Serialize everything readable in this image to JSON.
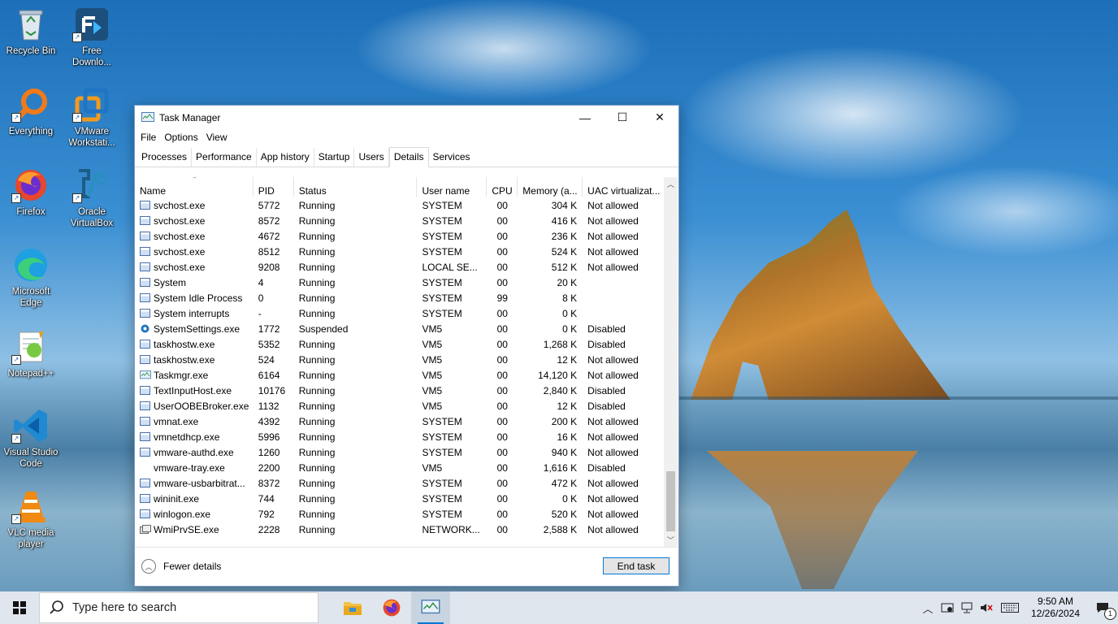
{
  "desktop": {
    "icons": [
      {
        "label": "Recycle Bin",
        "icon": "recycle-bin-icon"
      },
      {
        "label": "Free\nDownlo...",
        "icon": "free-download-manager-icon"
      },
      {
        "label": "Everything",
        "icon": "everything-search-icon"
      },
      {
        "label": "VMware\nWorkstati...",
        "icon": "vmware-workstation-icon"
      },
      {
        "label": "Firefox",
        "icon": "firefox-icon"
      },
      {
        "label": "Oracle\nVirtualBox",
        "icon": "virtualbox-icon"
      },
      {
        "label": "Microsoft\nEdge",
        "icon": "edge-icon"
      },
      {
        "label": "Notepad++",
        "icon": "notepadpp-icon"
      },
      {
        "label": "Visual Studio\nCode",
        "icon": "vscode-icon"
      },
      {
        "label": "VLC media\nplayer",
        "icon": "vlc-icon"
      }
    ]
  },
  "window": {
    "title": "Task Manager",
    "controls": {
      "minimize": "—",
      "maximize": "☐",
      "close": "✕"
    },
    "menu": [
      "File",
      "Options",
      "View"
    ],
    "tabs": [
      "Processes",
      "Performance",
      "App history",
      "Startup",
      "Users",
      "Details",
      "Services"
    ],
    "active_tab": "Details",
    "columns": [
      "Name",
      "PID",
      "Status",
      "User name",
      "CPU",
      "Memory (a...",
      "UAC virtualizat..."
    ],
    "rows": [
      {
        "name": "svchost.exe",
        "pid": "5772",
        "status": "Running",
        "user": "SYSTEM",
        "cpu": "00",
        "mem": "304 K",
        "uac": "Not allowed",
        "icon": "service-host"
      },
      {
        "name": "svchost.exe",
        "pid": "8572",
        "status": "Running",
        "user": "SYSTEM",
        "cpu": "00",
        "mem": "416 K",
        "uac": "Not allowed",
        "icon": "service-host"
      },
      {
        "name": "svchost.exe",
        "pid": "4672",
        "status": "Running",
        "user": "SYSTEM",
        "cpu": "00",
        "mem": "236 K",
        "uac": "Not allowed",
        "icon": "service-host"
      },
      {
        "name": "svchost.exe",
        "pid": "8512",
        "status": "Running",
        "user": "SYSTEM",
        "cpu": "00",
        "mem": "524 K",
        "uac": "Not allowed",
        "icon": "service-host"
      },
      {
        "name": "svchost.exe",
        "pid": "9208",
        "status": "Running",
        "user": "LOCAL SE...",
        "cpu": "00",
        "mem": "512 K",
        "uac": "Not allowed",
        "icon": "service-host"
      },
      {
        "name": "System",
        "pid": "4",
        "status": "Running",
        "user": "SYSTEM",
        "cpu": "00",
        "mem": "20 K",
        "uac": "",
        "icon": "window"
      },
      {
        "name": "System Idle Process",
        "pid": "0",
        "status": "Running",
        "user": "SYSTEM",
        "cpu": "99",
        "mem": "8 K",
        "uac": "",
        "icon": "window"
      },
      {
        "name": "System interrupts",
        "pid": "-",
        "status": "Running",
        "user": "SYSTEM",
        "cpu": "00",
        "mem": "0 K",
        "uac": "",
        "icon": "window"
      },
      {
        "name": "SystemSettings.exe",
        "pid": "1772",
        "status": "Suspended",
        "user": "VM5",
        "cpu": "00",
        "mem": "0 K",
        "uac": "Disabled",
        "icon": "settings-gear"
      },
      {
        "name": "taskhostw.exe",
        "pid": "5352",
        "status": "Running",
        "user": "VM5",
        "cpu": "00",
        "mem": "1,268 K",
        "uac": "Disabled",
        "icon": "window"
      },
      {
        "name": "taskhostw.exe",
        "pid": "524",
        "status": "Running",
        "user": "VM5",
        "cpu": "00",
        "mem": "12 K",
        "uac": "Not allowed",
        "icon": "window"
      },
      {
        "name": "Taskmgr.exe",
        "pid": "6164",
        "status": "Running",
        "user": "VM5",
        "cpu": "00",
        "mem": "14,120 K",
        "uac": "Not allowed",
        "icon": "task-manager"
      },
      {
        "name": "TextInputHost.exe",
        "pid": "10176",
        "status": "Running",
        "user": "VM5",
        "cpu": "00",
        "mem": "2,840 K",
        "uac": "Disabled",
        "icon": "window"
      },
      {
        "name": "UserOOBEBroker.exe",
        "pid": "1132",
        "status": "Running",
        "user": "VM5",
        "cpu": "00",
        "mem": "12 K",
        "uac": "Disabled",
        "icon": "window"
      },
      {
        "name": "vmnat.exe",
        "pid": "4392",
        "status": "Running",
        "user": "SYSTEM",
        "cpu": "00",
        "mem": "200 K",
        "uac": "Not allowed",
        "icon": "window"
      },
      {
        "name": "vmnetdhcp.exe",
        "pid": "5996",
        "status": "Running",
        "user": "SYSTEM",
        "cpu": "00",
        "mem": "16 K",
        "uac": "Not allowed",
        "icon": "window"
      },
      {
        "name": "vmware-authd.exe",
        "pid": "1260",
        "status": "Running",
        "user": "SYSTEM",
        "cpu": "00",
        "mem": "940 K",
        "uac": "Not allowed",
        "icon": "window"
      },
      {
        "name": "vmware-tray.exe",
        "pid": "2200",
        "status": "Running",
        "user": "VM5",
        "cpu": "00",
        "mem": "1,616 K",
        "uac": "Disabled",
        "icon": "none"
      },
      {
        "name": "vmware-usbarbitrat...",
        "pid": "8372",
        "status": "Running",
        "user": "SYSTEM",
        "cpu": "00",
        "mem": "472 K",
        "uac": "Not allowed",
        "icon": "window"
      },
      {
        "name": "wininit.exe",
        "pid": "744",
        "status": "Running",
        "user": "SYSTEM",
        "cpu": "00",
        "mem": "0 K",
        "uac": "Not allowed",
        "icon": "window"
      },
      {
        "name": "winlogon.exe",
        "pid": "792",
        "status": "Running",
        "user": "SYSTEM",
        "cpu": "00",
        "mem": "520 K",
        "uac": "Not allowed",
        "icon": "window"
      },
      {
        "name": "WmiPrvSE.exe",
        "pid": "2228",
        "status": "Running",
        "user": "NETWORK...",
        "cpu": "00",
        "mem": "2,588 K",
        "uac": "Not allowed",
        "icon": "wmi"
      }
    ],
    "footer": {
      "fewer_details": "Fewer details",
      "end_task": "End task"
    }
  },
  "taskbar": {
    "search_placeholder": "Type here to search",
    "pinned": [
      "file-explorer-icon",
      "firefox-icon",
      "task-manager-icon"
    ],
    "time": "9:50 AM",
    "date": "12/26/2024",
    "tray_icons": [
      "chevron-up-icon",
      "network-security-icon",
      "network-icon",
      "volume-muted-icon",
      "keyboard-icon",
      "notification-icon"
    ],
    "notification_count": "1"
  },
  "colors": {
    "accent": "#0078d7",
    "taskbar": "#dfe6ee"
  }
}
